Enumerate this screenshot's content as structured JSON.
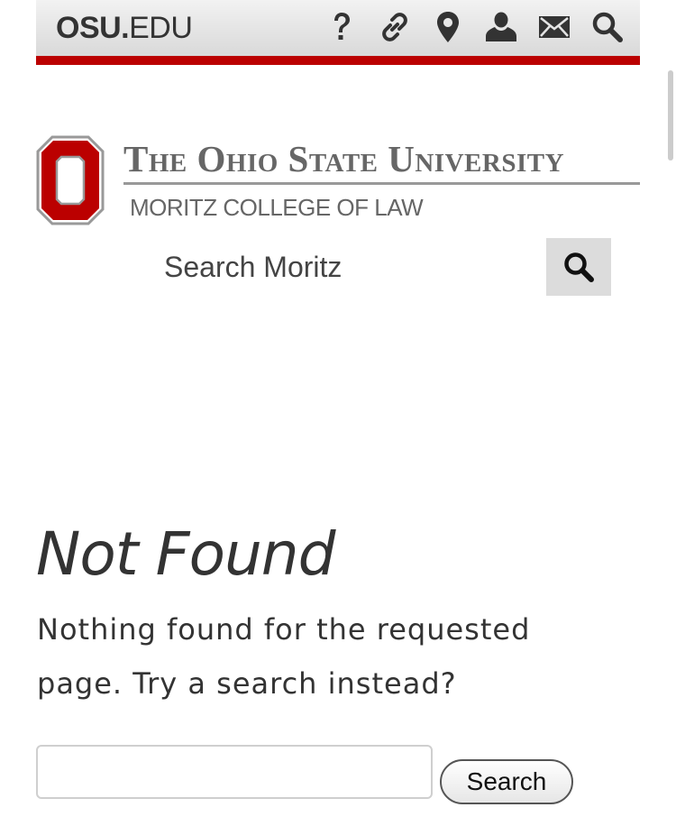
{
  "osu_navbar": {
    "logo_bold": "OSU.",
    "logo_light": "EDU",
    "icons": [
      "help-icon",
      "link-icon",
      "map-marker-icon",
      "user-icon",
      "mail-icon",
      "search-icon"
    ],
    "accent_color": "#bb0000"
  },
  "masthead": {
    "university_name": "The Ohio State University",
    "college_name": "MORITZ COLLEGE OF LAW",
    "logo_color": "#bb0000"
  },
  "site_search": {
    "placeholder": "Search Moritz"
  },
  "main": {
    "title": "Not Found",
    "message": "Nothing found for the requested page. Try a search instead?",
    "search_value": "",
    "search_button_label": "Search"
  }
}
